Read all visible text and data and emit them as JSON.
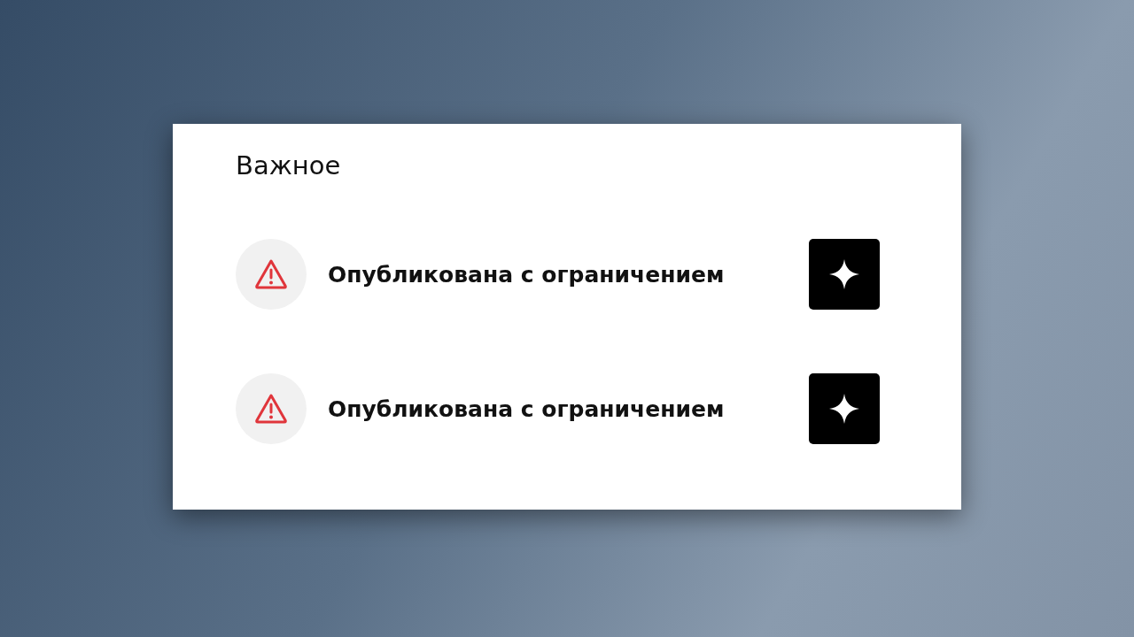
{
  "card": {
    "title": "Важное",
    "items": [
      {
        "label": "Опубликована с ограничением"
      },
      {
        "label": "Опубликована с ограничением"
      }
    ]
  }
}
